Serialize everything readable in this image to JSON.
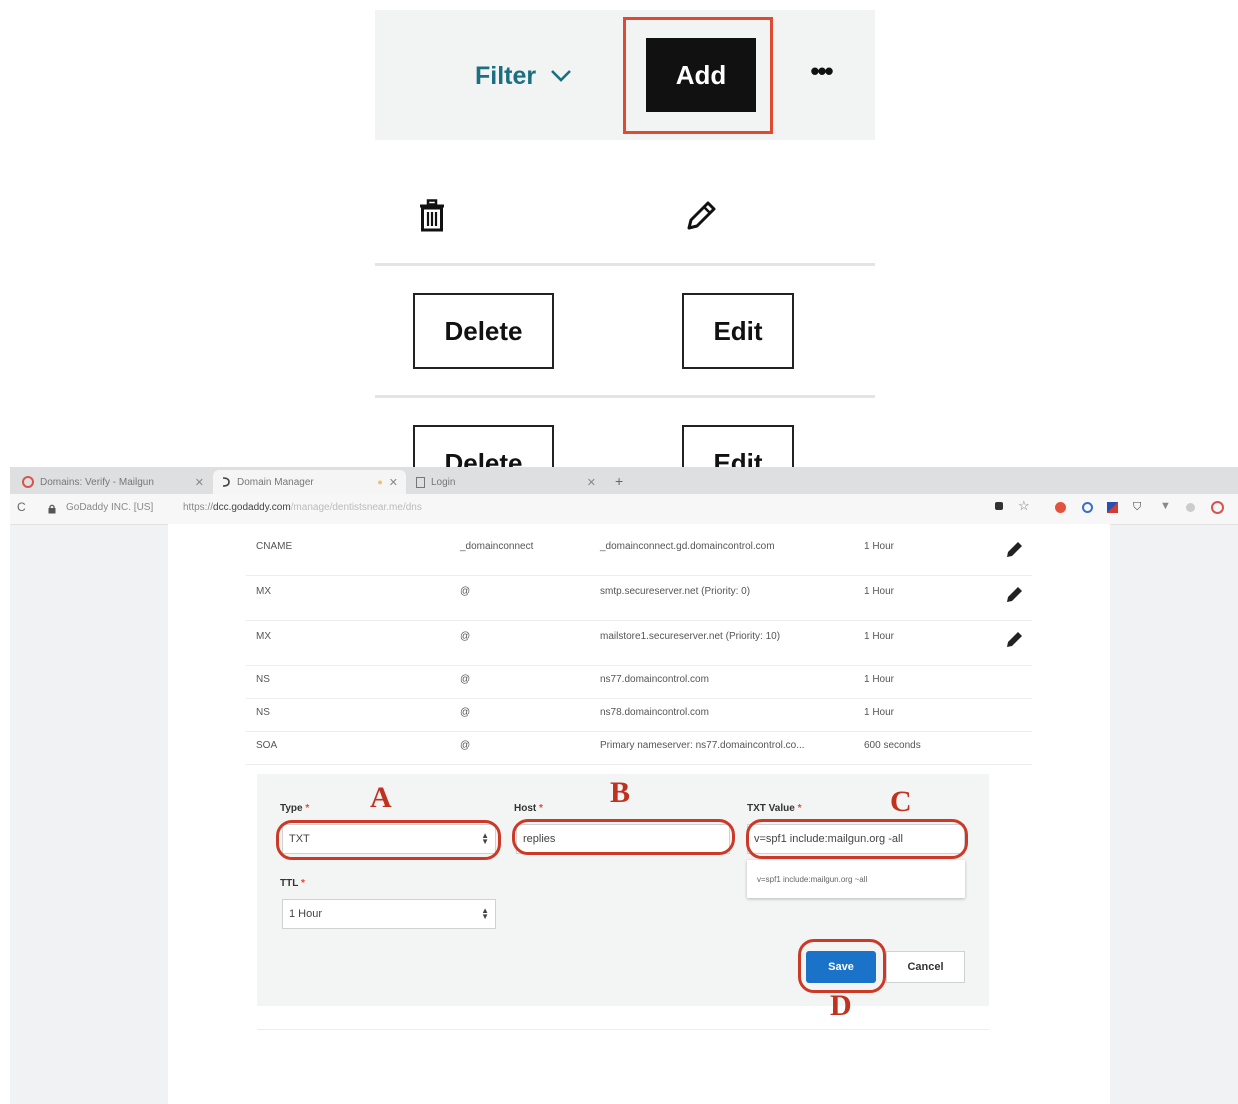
{
  "top_panel": {
    "filter_label": "Filter",
    "add_label": "Add",
    "more_label": "•••",
    "rows": [
      {
        "delete_label": "Delete",
        "edit_label": "Edit"
      },
      {
        "delete_label": "Delete",
        "edit_label": "Edit"
      }
    ]
  },
  "browser": {
    "tabs": [
      {
        "title": "Domains: Verify - Mailgun"
      },
      {
        "title": "Domain Manager"
      },
      {
        "title": "Login"
      }
    ],
    "new_tab_label": "+",
    "address": {
      "reload_glyph": "C",
      "security_label": "GoDaddy INC. [US]",
      "url_prefix": "https://",
      "url_host": "dcc.godaddy.com",
      "url_path": "/manage/dentistsnear.me/dns"
    },
    "dns_records": [
      {
        "type": "CNAME",
        "name": "_domainconnect",
        "value": "_domainconnect.gd.domaincontrol.com",
        "ttl": "1 Hour",
        "editable": true
      },
      {
        "type": "MX",
        "name": "@",
        "value": "smtp.secureserver.net (Priority: 0)",
        "ttl": "1 Hour",
        "editable": true
      },
      {
        "type": "MX",
        "name": "@",
        "value": "mailstore1.secureserver.net (Priority: 10)",
        "ttl": "1 Hour",
        "editable": true
      },
      {
        "type": "NS",
        "name": "@",
        "value": "ns77.domaincontrol.com",
        "ttl": "1 Hour",
        "editable": false
      },
      {
        "type": "NS",
        "name": "@",
        "value": "ns78.domaincontrol.com",
        "ttl": "1 Hour",
        "editable": false
      },
      {
        "type": "SOA",
        "name": "@",
        "value": "Primary nameserver: ns77.domaincontrol.co...",
        "ttl": "600 seconds",
        "editable": false
      }
    ],
    "form": {
      "type_label": "Type",
      "type_value": "TXT",
      "host_label": "Host",
      "host_value": "replies",
      "txt_label": "TXT Value",
      "txt_value": "v=spf1 include:mailgun.org -all",
      "txt_suggestion": "v=spf1 include:mailgun.org ~all",
      "ttl_label": "TTL",
      "ttl_value": "1 Hour",
      "required_mark": "*",
      "save_label": "Save",
      "cancel_label": "Cancel"
    }
  },
  "annotations": {
    "markers": [
      "A",
      "B",
      "C",
      "D"
    ],
    "highlight_color": "#e04a32"
  },
  "colors": {
    "filter_teal": "#1b6f80",
    "add_button_bg": "#111111",
    "save_blue": "#1a73c8",
    "annotation_red": "#c0311f"
  }
}
